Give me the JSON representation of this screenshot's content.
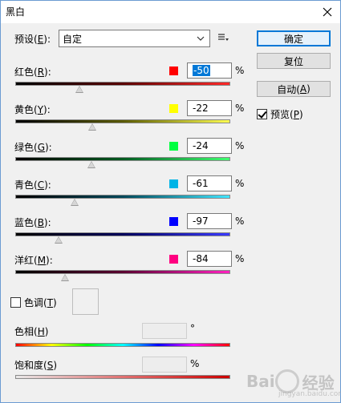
{
  "window": {
    "title": "黑白"
  },
  "preset": {
    "label": "预设(E):",
    "label_main": "预设(",
    "label_key": "E",
    "label_end": "):",
    "value": "自定"
  },
  "buttons": {
    "ok": "确定",
    "reset": "复位",
    "auto_main": "自动(",
    "auto_key": "A",
    "auto_end": ")"
  },
  "preview": {
    "label_main": "预览(",
    "label_key": "P",
    "label_end": ")",
    "checked": true
  },
  "channels": [
    {
      "name_main": "红色(",
      "key": "R",
      "name_end": "):",
      "value": "-50",
      "swatch": "#ff0000",
      "slider": 0.3
    },
    {
      "name_main": "黄色(",
      "key": "Y",
      "name_end": "):",
      "value": "-22",
      "swatch": "#ffff00",
      "slider": 0.358
    },
    {
      "name_main": "绿色(",
      "key": "G",
      "name_end": "):",
      "value": "-24",
      "swatch": "#00ff40",
      "slider": 0.354
    },
    {
      "name_main": "青色(",
      "key": "C",
      "name_end": "):",
      "value": "-61",
      "swatch": "#00b4e6",
      "slider": 0.277
    },
    {
      "name_main": "蓝色(",
      "key": "B",
      "name_end": "):",
      "value": "-97",
      "swatch": "#0000ff",
      "slider": 0.203
    },
    {
      "name_main": "洋红(",
      "key": "M",
      "name_end": "):",
      "value": "-84",
      "swatch": "#ff0080",
      "slider": 0.232
    }
  ],
  "percent": "%",
  "tint": {
    "label_main": "色调(",
    "label_key": "T",
    "label_end": ")",
    "checked": false
  },
  "hue": {
    "label_main": "色相(",
    "label_key": "H",
    "label_end": ")",
    "unit": "°"
  },
  "saturation": {
    "label_main": "饱和度(",
    "label_key": "S",
    "label_end": ")",
    "unit": "%"
  },
  "watermark": {
    "text": "Bai",
    "text2": "经验",
    "sub": "jingyan.baidu.com"
  }
}
